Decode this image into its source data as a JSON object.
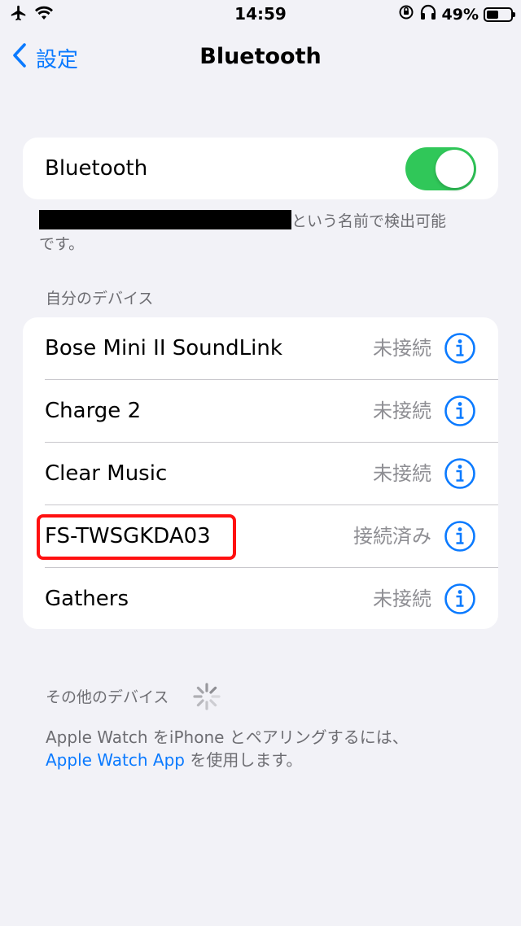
{
  "status_bar": {
    "time": "14:59",
    "battery_text": "49%",
    "battery_level": 0.49,
    "icons": [
      "airplane-icon",
      "wifi-icon",
      "orientation-lock-icon",
      "headphones-icon",
      "battery-icon"
    ]
  },
  "nav": {
    "back_label": "設定",
    "title": "Bluetooth"
  },
  "bluetooth_toggle": {
    "label": "Bluetooth",
    "on": true,
    "color": "#30c759"
  },
  "discoverable": {
    "suffix": "という名前で検出可能",
    "line2": "です。"
  },
  "my_devices": {
    "header": "自分のデバイス",
    "items": [
      {
        "name": "Bose Mini II SoundLink",
        "status": "未接続"
      },
      {
        "name": "Charge 2",
        "status": "未接続"
      },
      {
        "name": "Clear Music",
        "status": "未接続"
      },
      {
        "name": "FS-TWSGKDA03",
        "status": "接続済み"
      },
      {
        "name": "Gathers",
        "status": "未接続"
      }
    ]
  },
  "other_devices": {
    "header": "その他のデバイス"
  },
  "footer": {
    "text_before": "Apple Watch をiPhone とペアリングするには、",
    "link": "Apple Watch App",
    "text_after": " を使用します。"
  },
  "colors": {
    "accent": "#0a7aff",
    "highlight": "#ff1010"
  }
}
